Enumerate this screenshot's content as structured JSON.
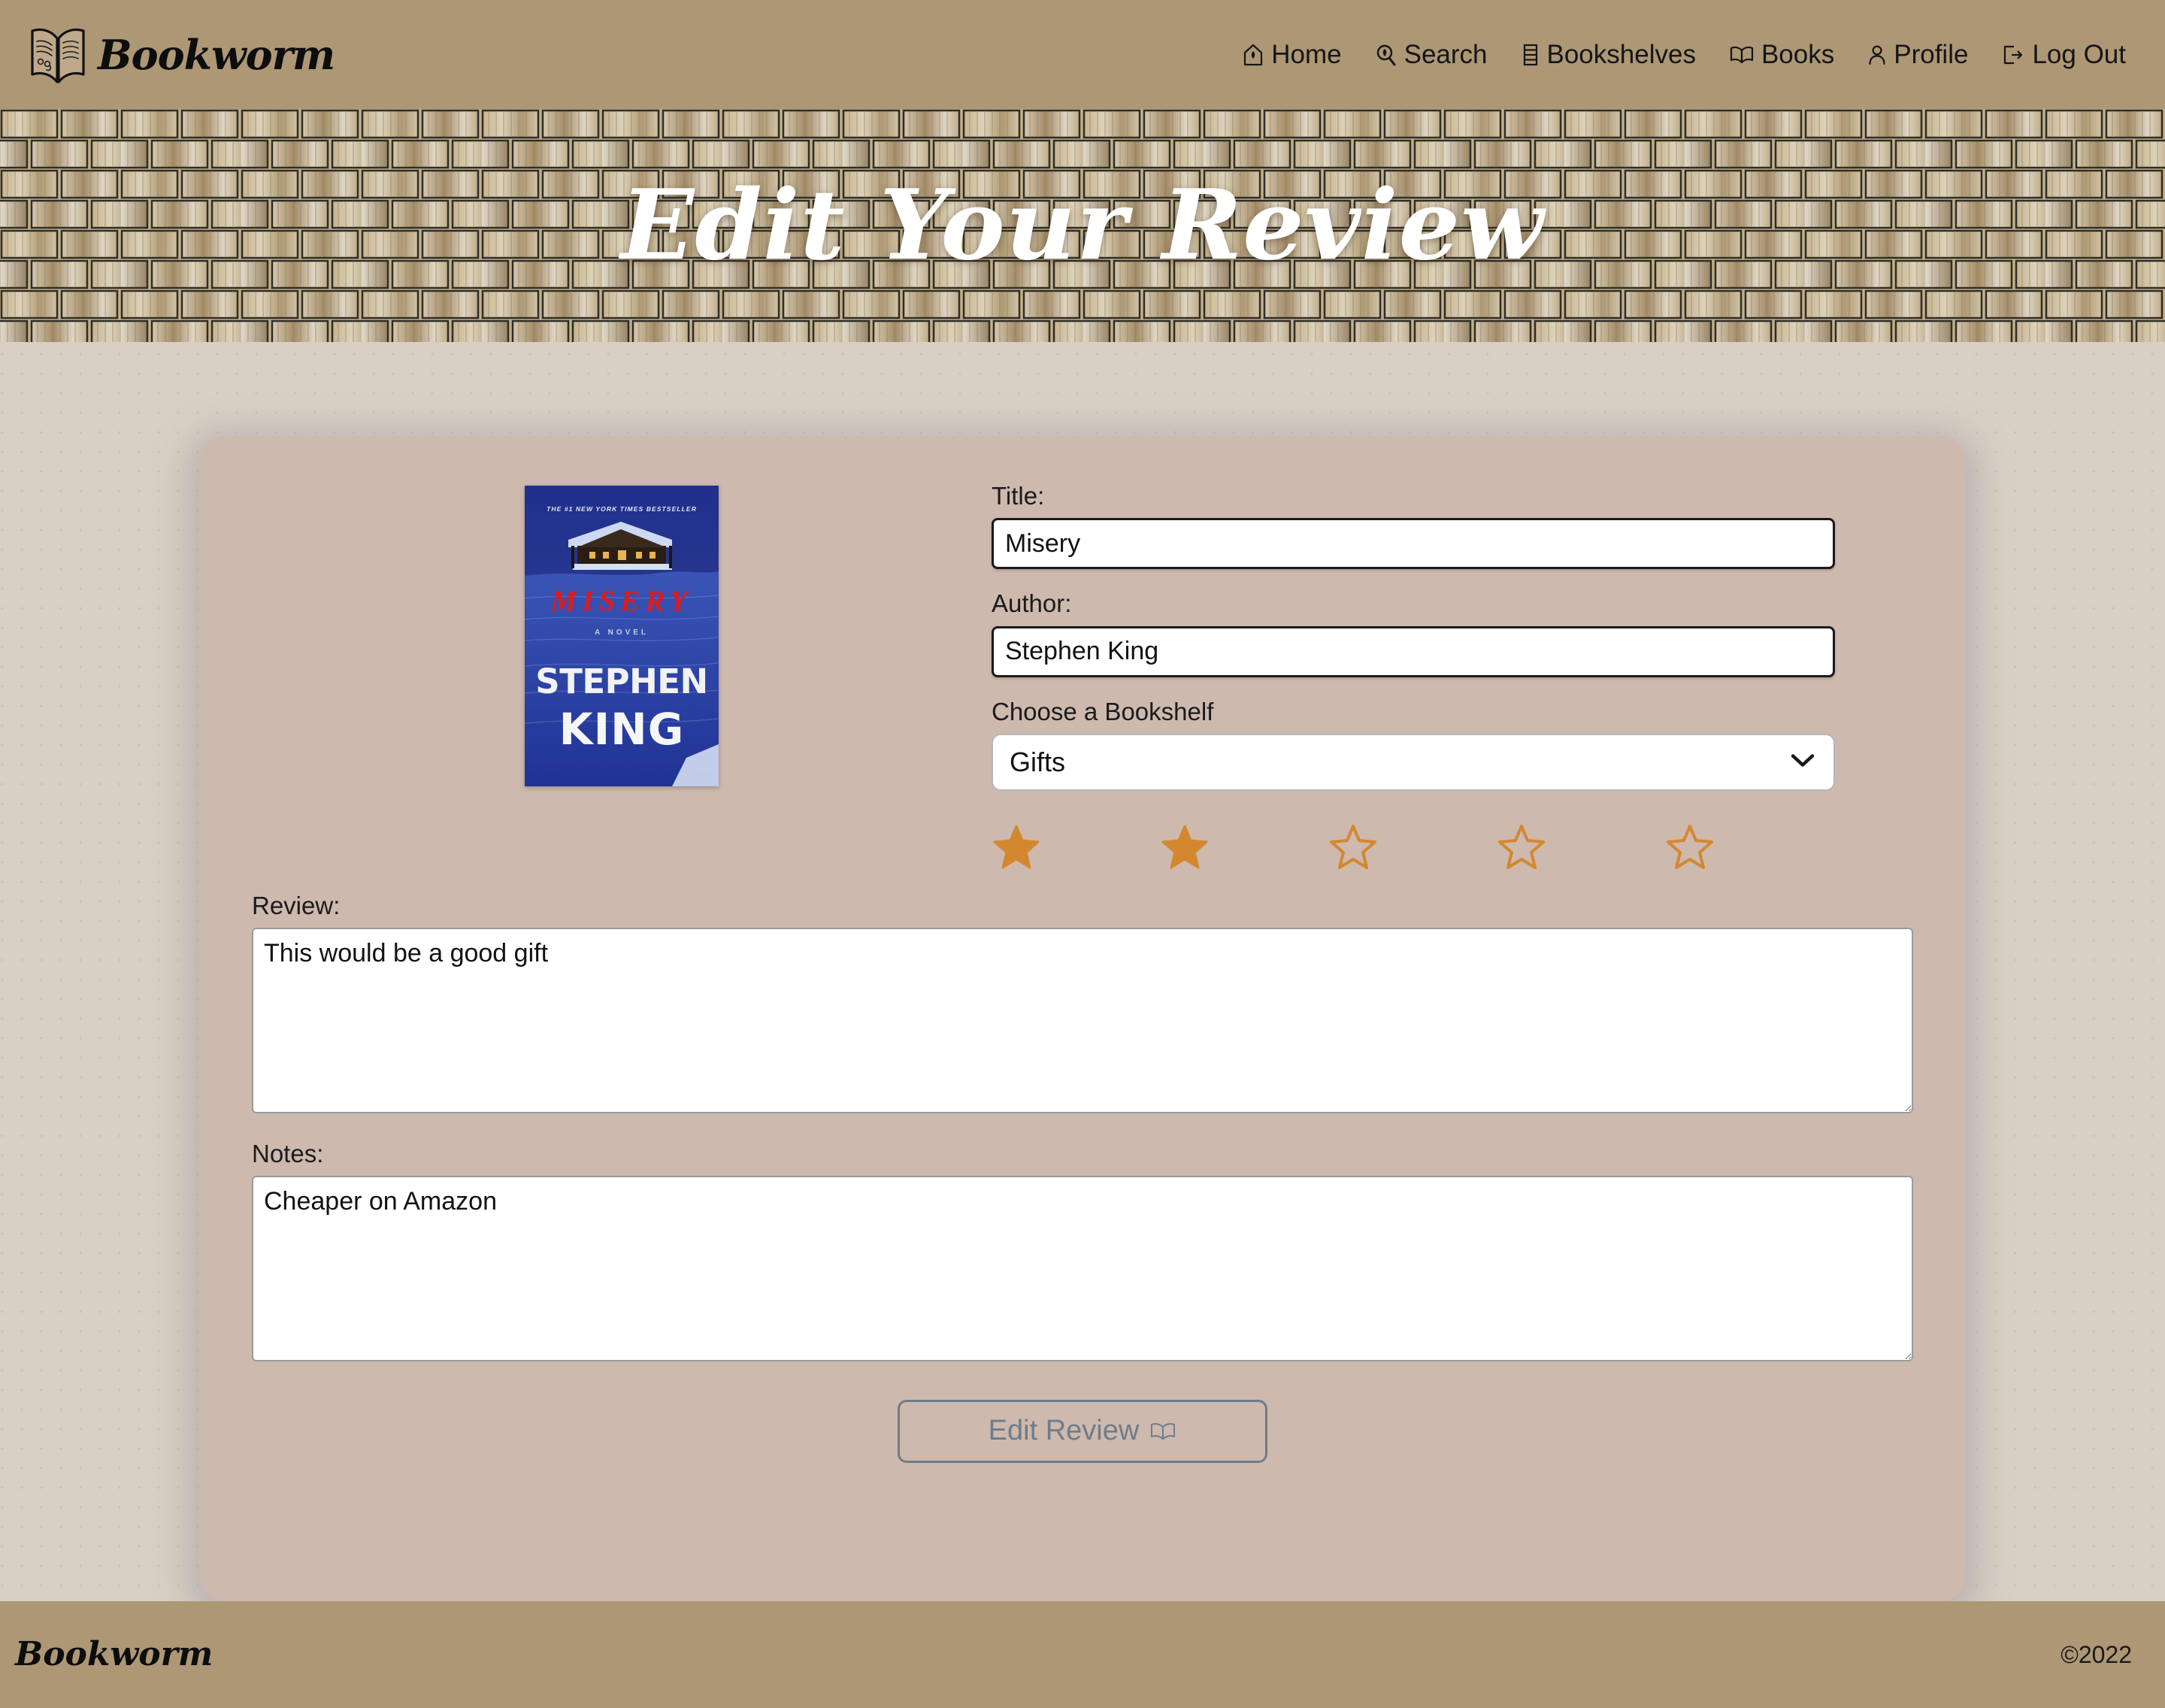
{
  "colors": {
    "header_bar": "#ad9775",
    "page_bg": "#d9d0c3",
    "card_bg": "#ceb9ae",
    "star_filled": "#d3882f",
    "star_empty": "#d3882f",
    "button_outline": "#6f7c89",
    "input_border": "#1a1a1a"
  },
  "header": {
    "brand": "Bookworm",
    "brand_icon": "open-book-logo-icon",
    "nav": [
      {
        "label": "Home",
        "icon": "home-icon"
      },
      {
        "label": "Search",
        "icon": "search-icon"
      },
      {
        "label": "Bookshelves",
        "icon": "bookshelf-list-icon"
      },
      {
        "label": "Books",
        "icon": "open-book-icon"
      },
      {
        "label": "Profile",
        "icon": "person-icon"
      },
      {
        "label": "Log Out",
        "icon": "logout-icon"
      }
    ]
  },
  "hero": {
    "title": "Edit Your Review",
    "background": "stacked-open-books-photo"
  },
  "form": {
    "cover": {
      "alt": "Misery book cover",
      "banner_text": "THE #1 NEW YORK TIMES BESTSELLER",
      "cover_title": "MISERY",
      "cover_subtitle": "A NOVEL",
      "cover_author_line1": "STEPHEN",
      "cover_author_line2": "KING"
    },
    "title_label": "Title:",
    "title_value": "Misery",
    "author_label": "Author:",
    "author_value": "Stephen King",
    "bookshelf_label": "Choose a Bookshelf",
    "bookshelf_value": "Gifts",
    "bookshelf_options": [
      "Gifts"
    ],
    "rating": 2,
    "rating_max": 5,
    "review_label": "Review:",
    "review_value": "This would be a good gift",
    "notes_label": "Notes:",
    "notes_value": "Cheaper on Amazon",
    "submit_label": "Edit Review",
    "submit_icon": "open-book-icon"
  },
  "footer": {
    "brand": "Bookworm",
    "copyright": "©2022"
  }
}
